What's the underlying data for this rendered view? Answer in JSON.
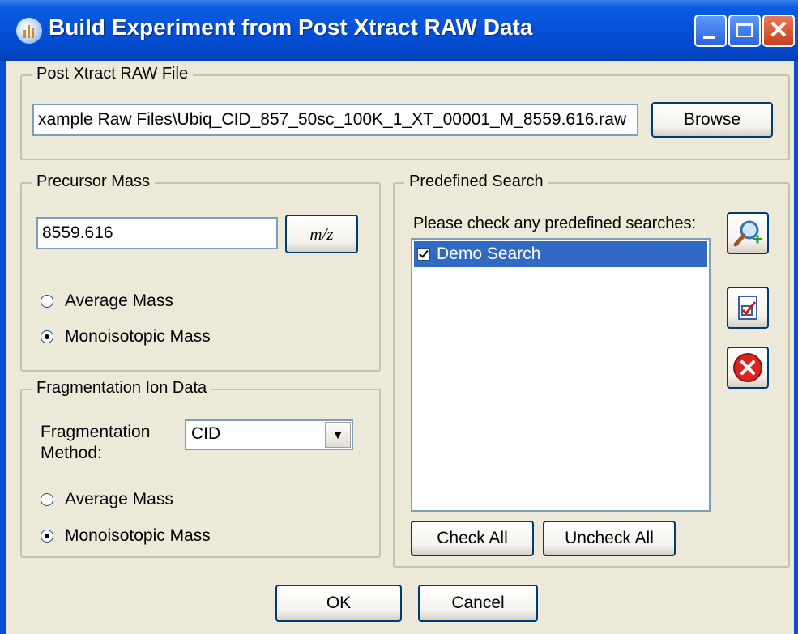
{
  "window": {
    "title": "Build Experiment from Post Xtract RAW Data",
    "minimize_icon": "minimize-icon",
    "maximize_icon": "maximize-icon",
    "close_glyph": "✕"
  },
  "raw_file": {
    "legend": "Post Xtract RAW File",
    "path": "xample Raw Files\\Ubiq_CID_857_50sc_100K_1_XT_00001_M_8559.616.raw",
    "browse_label": "Browse"
  },
  "precursor": {
    "legend": "Precursor Mass",
    "mass_value": "8559.616",
    "mz_label": "m/z",
    "average_label": "Average Mass",
    "mono_label": "Monoisotopic Mass",
    "selected": "Monoisotopic Mass"
  },
  "fragmentation": {
    "legend": "Fragmentation Ion Data",
    "method_label_line1": "Fragmentation",
    "method_label_line2": "Method:",
    "method_value": "CID",
    "average_label": "Average Mass",
    "mono_label": "Monoisotopic Mass",
    "selected": "Monoisotopic Mass"
  },
  "predefined": {
    "legend": "Predefined Search",
    "prompt": "Please check any predefined searches:",
    "items": [
      {
        "label": "Demo Search",
        "checked": true,
        "selected": true
      }
    ],
    "check_all_label": "Check All",
    "uncheck_all_label": "Uncheck All",
    "side_icons": [
      "add-search-icon",
      "edit-search-icon",
      "delete-search-icon"
    ]
  },
  "footer": {
    "ok_label": "OK",
    "cancel_label": "Cancel"
  },
  "colors": {
    "title_bar": "#0550d8",
    "face": "#ece9d8",
    "selection": "#316ac5",
    "close_button": "#c4401f"
  }
}
